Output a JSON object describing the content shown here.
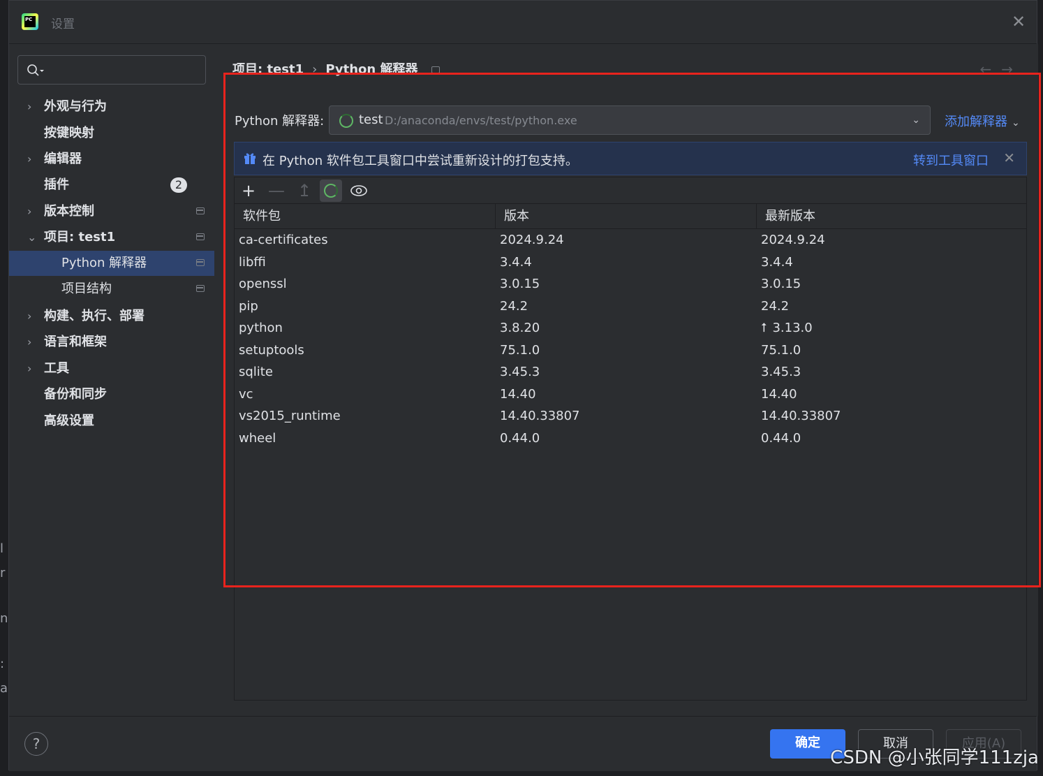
{
  "window": {
    "title": "设置"
  },
  "search": {
    "placeholder": ""
  },
  "sidebar": {
    "items": [
      {
        "label": "外观与行为",
        "expandable": true
      },
      {
        "label": "按键映射",
        "expandable": false
      },
      {
        "label": "编辑器",
        "expandable": true
      },
      {
        "label": "插件",
        "expandable": false,
        "badge": "2"
      },
      {
        "label": "版本控制",
        "expandable": true,
        "pinned": true
      },
      {
        "label": "项目: test1",
        "expandable": true,
        "expanded": true,
        "pinned": true
      },
      {
        "label": "Python 解释器",
        "sub": true,
        "selected": true,
        "pinned": true
      },
      {
        "label": "项目结构",
        "sub": true,
        "pinned": true
      },
      {
        "label": "构建、执行、部署",
        "expandable": true
      },
      {
        "label": "语言和框架",
        "expandable": true
      },
      {
        "label": "工具",
        "expandable": true
      },
      {
        "label": "备份和同步",
        "expandable": false
      },
      {
        "label": "高级设置",
        "expandable": false
      }
    ]
  },
  "breadcrumb": {
    "project": "项目: test1",
    "separator": "›",
    "page": "Python 解释器"
  },
  "interpreter": {
    "label": "Python 解释器:",
    "name": "test",
    "path": "D:/anaconda/envs/test/python.exe",
    "add_label": "添加解释器"
  },
  "banner": {
    "message": "在 Python 软件包工具窗口中尝试重新设计的打包支持。",
    "link": "转到工具窗口"
  },
  "table": {
    "headers": [
      "软件包",
      "版本",
      "最新版本"
    ],
    "rows": [
      {
        "package": "ca-certificates",
        "version": "2024.9.24",
        "latest": "2024.9.24",
        "upgrade": false
      },
      {
        "package": "libffi",
        "version": "3.4.4",
        "latest": "3.4.4",
        "upgrade": false
      },
      {
        "package": "openssl",
        "version": "3.0.15",
        "latest": "3.0.15",
        "upgrade": false
      },
      {
        "package": "pip",
        "version": "24.2",
        "latest": "24.2",
        "upgrade": false
      },
      {
        "package": "python",
        "version": "3.8.20",
        "latest": "3.13.0",
        "upgrade": true
      },
      {
        "package": "setuptools",
        "version": "75.1.0",
        "latest": "75.1.0",
        "upgrade": false
      },
      {
        "package": "sqlite",
        "version": "3.45.3",
        "latest": "3.45.3",
        "upgrade": false
      },
      {
        "package": "vc",
        "version": "14.40",
        "latest": "14.40",
        "upgrade": false
      },
      {
        "package": "vs2015_runtime",
        "version": "14.40.33807",
        "latest": "14.40.33807",
        "upgrade": false
      },
      {
        "package": "wheel",
        "version": "0.44.0",
        "latest": "0.44.0",
        "upgrade": false
      }
    ]
  },
  "footer": {
    "ok": "确定",
    "cancel": "取消",
    "apply": "应用(A)",
    "help": "?"
  },
  "watermark": "CSDN @小张同学111zja",
  "colors": {
    "accent": "#3574f0",
    "link": "#548af7",
    "selection": "#2e436e",
    "annotation": "#e8231d"
  }
}
